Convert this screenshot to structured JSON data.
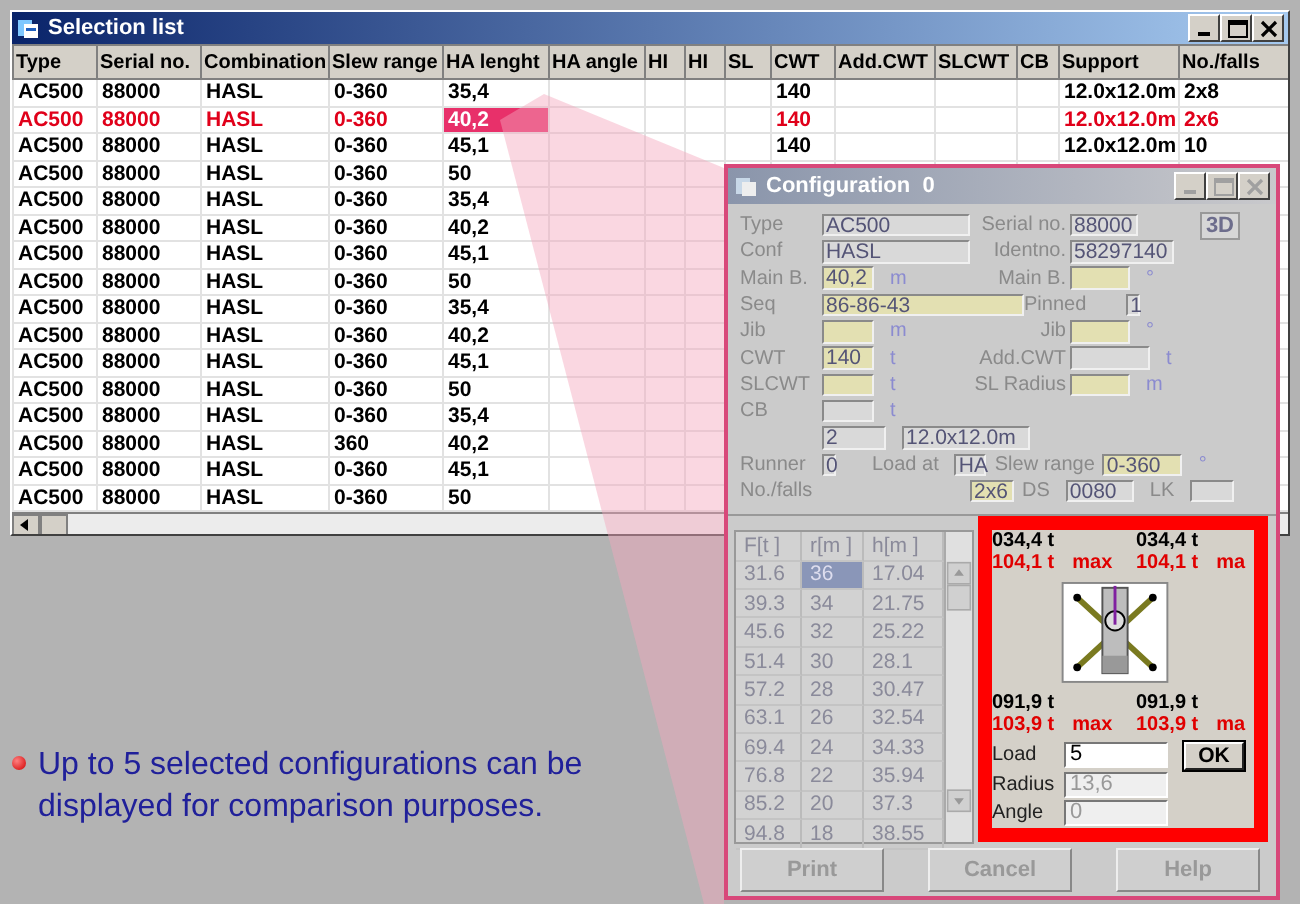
{
  "selection_list": {
    "title": "Selection list",
    "columns": [
      "Type",
      "Serial no.",
      "Combination",
      "Slew range",
      "HA lenght",
      "HA angle",
      "HI",
      "HI",
      "SL",
      "CWT",
      "Add.CWT",
      "SLCWT",
      "CB",
      "Support",
      "No./falls"
    ],
    "rows": [
      {
        "type": "AC500",
        "serial_no": "88000",
        "combination": "HASL",
        "slew_range": "0-360",
        "ha_length": "35,4",
        "cwt": "140",
        "support": "12.0x12.0m",
        "falls": "2x8",
        "selected": false
      },
      {
        "type": "AC500",
        "serial_no": "88000",
        "combination": "HASL",
        "slew_range": "0-360",
        "ha_length": "40,2",
        "cwt": "140",
        "support": "12.0x12.0m",
        "falls": "2x6",
        "selected": true
      },
      {
        "type": "AC500",
        "serial_no": "88000",
        "combination": "HASL",
        "slew_range": "0-360",
        "ha_length": "45,1",
        "cwt": "140",
        "support": "12.0x12.0m",
        "falls": "10",
        "selected": false
      },
      {
        "type": "AC500",
        "serial_no": "88000",
        "combination": "HASL",
        "slew_range": "0-360",
        "ha_length": "50",
        "selected": false
      },
      {
        "type": "AC500",
        "serial_no": "88000",
        "combination": "HASL",
        "slew_range": "0-360",
        "ha_length": "35,4",
        "selected": false
      },
      {
        "type": "AC500",
        "serial_no": "88000",
        "combination": "HASL",
        "slew_range": "0-360",
        "ha_length": "40,2",
        "selected": false
      },
      {
        "type": "AC500",
        "serial_no": "88000",
        "combination": "HASL",
        "slew_range": "0-360",
        "ha_length": "45,1",
        "selected": false
      },
      {
        "type": "AC500",
        "serial_no": "88000",
        "combination": "HASL",
        "slew_range": "0-360",
        "ha_length": "50",
        "selected": false
      },
      {
        "type": "AC500",
        "serial_no": "88000",
        "combination": "HASL",
        "slew_range": "0-360",
        "ha_length": "35,4",
        "selected": false
      },
      {
        "type": "AC500",
        "serial_no": "88000",
        "combination": "HASL",
        "slew_range": "0-360",
        "ha_length": "40,2",
        "selected": false
      },
      {
        "type": "AC500",
        "serial_no": "88000",
        "combination": "HASL",
        "slew_range": "0-360",
        "ha_length": "45,1",
        "selected": false
      },
      {
        "type": "AC500",
        "serial_no": "88000",
        "combination": "HASL",
        "slew_range": "0-360",
        "ha_length": "50",
        "selected": false
      },
      {
        "type": "AC500",
        "serial_no": "88000",
        "combination": "HASL",
        "slew_range": "0-360",
        "ha_length": "35,4",
        "selected": false
      },
      {
        "type": "AC500",
        "serial_no": "88000",
        "combination": "HASL",
        "slew_range": "360",
        "ha_length": "40,2",
        "selected": false
      },
      {
        "type": "AC500",
        "serial_no": "88000",
        "combination": "HASL",
        "slew_range": "0-360",
        "ha_length": "45,1",
        "selected": false
      },
      {
        "type": "AC500",
        "serial_no": "88000",
        "combination": "HASL",
        "slew_range": "0-360",
        "ha_length": "50",
        "selected": false
      }
    ]
  },
  "note": "Up to 5 selected configurations can be displayed for comparison purposes.",
  "configuration": {
    "title": "Configuration  0",
    "badge": "3D",
    "fields": {
      "type": {
        "label": "Type",
        "value": "AC500",
        "editable": false
      },
      "serial_no": {
        "label": "Serial no.",
        "value": "88000",
        "editable": false
      },
      "conf": {
        "label": "Conf",
        "value": "HASL",
        "editable": false
      },
      "ident_no": {
        "label": "Identno.",
        "value": "58297140",
        "editable": false
      },
      "main_boom": {
        "label": "Main B.",
        "value": "40,2",
        "unit": "m",
        "editable": true
      },
      "main_boom_angle": {
        "label": "Main B.",
        "unit": "°",
        "editable": true
      },
      "seq": {
        "label": "Seq",
        "value": "86-86-43",
        "editable": true
      },
      "pinned": {
        "label": "Pinned",
        "value": "1",
        "editable": false
      },
      "jib": {
        "label": "Jib",
        "unit": "m",
        "editable": true
      },
      "jib_angle": {
        "label": "Jib",
        "unit": "°",
        "editable": true
      },
      "cwt": {
        "label": "CWT",
        "value": "140",
        "unit": "t",
        "editable": true
      },
      "add_cwt": {
        "label": "Add.CWT",
        "unit": "t",
        "editable": false
      },
      "slcwt": {
        "label": "SLCWT",
        "unit": "t",
        "editable": true
      },
      "sl_radius": {
        "label": "SL Radius",
        "unit": "m",
        "editable": true
      },
      "cb": {
        "label": "CB",
        "unit": "t",
        "editable": false
      },
      "count": {
        "value": "2",
        "editable": false
      },
      "support": {
        "value": "12.0x12.0m",
        "editable": false
      },
      "runner": {
        "label": "Runner",
        "value": "0",
        "editable": false
      },
      "load_at": {
        "label": "Load at",
        "value": "HA",
        "editable": false
      },
      "slew_range": {
        "label": "Slew range",
        "value": "0-360",
        "unit": "°",
        "editable": true
      },
      "falls": {
        "label": "No./falls",
        "value": "2x6",
        "editable": true
      },
      "ds": {
        "label": "DS",
        "value": "0080",
        "editable": false
      },
      "lk": {
        "label": "LK",
        "editable": false
      }
    },
    "radius_table": {
      "columns": [
        "F[t ]",
        "r[m ]",
        "h[m ]"
      ],
      "rows": [
        {
          "f": "31.6",
          "r": "36",
          "h": "17.04",
          "selected": true
        },
        {
          "f": "39.3",
          "r": "34",
          "h": "21.75",
          "selected": false
        },
        {
          "f": "45.6",
          "r": "32",
          "h": "25.22",
          "selected": false
        },
        {
          "f": "51.4",
          "r": "30",
          "h": "28.1",
          "selected": false
        },
        {
          "f": "57.2",
          "r": "28",
          "h": "30.47",
          "selected": false
        },
        {
          "f": "63.1",
          "r": "26",
          "h": "32.54",
          "selected": false
        },
        {
          "f": "69.4",
          "r": "24",
          "h": "34.33",
          "selected": false
        },
        {
          "f": "76.8",
          "r": "22",
          "h": "35.94",
          "selected": false
        },
        {
          "f": "85.2",
          "r": "20",
          "h": "37.3",
          "selected": false
        },
        {
          "f": "94.8",
          "r": "18",
          "h": "38.55",
          "selected": false
        }
      ]
    },
    "loads_top": [
      {
        "value": "034,4 t",
        "max": "104,1 t",
        "max_label": "max"
      },
      {
        "value": "034,4 t",
        "max": "104,1 t",
        "max_label": "ma"
      }
    ],
    "loads_bottom": [
      {
        "value": "091,9 t",
        "max": "103,9 t",
        "max_label": "max"
      },
      {
        "value": "091,9 t",
        "max": "103,9 t",
        "max_label": "ma"
      }
    ],
    "inputs": [
      {
        "label": "Load",
        "value": "5",
        "disabled": false
      },
      {
        "label": "Radius",
        "value": "13,6",
        "disabled": true
      },
      {
        "label": "Angle",
        "value": "0",
        "disabled": true
      }
    ],
    "ok": "OK",
    "buttons": [
      "Print",
      "Cancel",
      "Help"
    ]
  }
}
